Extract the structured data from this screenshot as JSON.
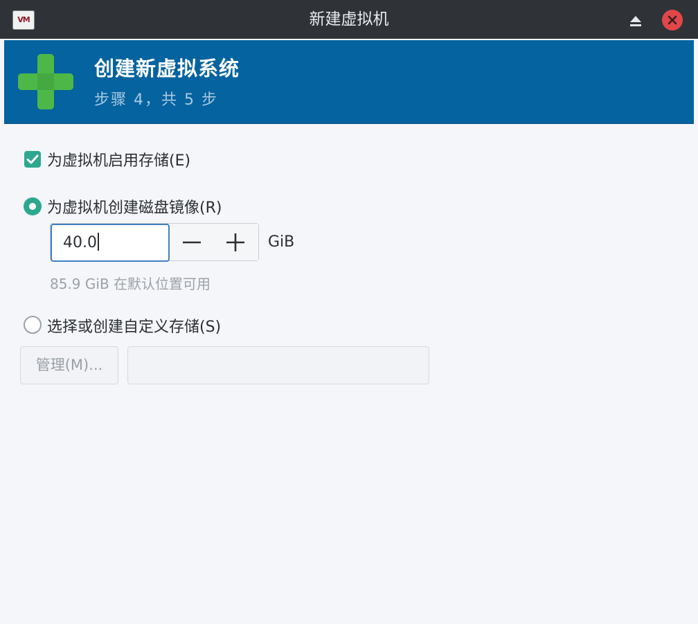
{
  "window": {
    "title": "新建虚拟机",
    "app_icon_text": "VM"
  },
  "banner": {
    "title": "创建新虚拟系统",
    "step": "步骤 4，共 5 步"
  },
  "storage": {
    "enable_label": "为虚拟机启用存储(E)",
    "enable_checked": true,
    "create_disk_label": "为虚拟机创建磁盘镜像(R)",
    "create_disk_selected": true,
    "disk_size_value": "40.0",
    "disk_size_unit": "GiB",
    "available_hint": "85.9 GiB 在默认位置可用",
    "custom_label": "选择或创建自定义存储(S)",
    "custom_selected": false,
    "manage_button": "管理(M)...",
    "custom_path_value": ""
  },
  "colors": {
    "titlebar": "#2f3338",
    "banner": "#05639f",
    "accent": "#2da88f",
    "close": "#e1464b",
    "plus_icon": "#4db848"
  }
}
